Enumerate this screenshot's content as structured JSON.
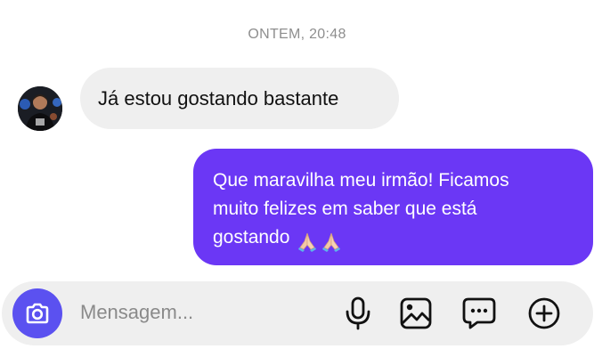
{
  "thread": {
    "timestamp": "ONTEM, 20:48"
  },
  "messages": [
    {
      "direction": "incoming",
      "text": "Já estou gostando bastante"
    },
    {
      "direction": "outgoing",
      "lines": [
        "Que maravilha meu irmão! Ficamos",
        "muito felizes em saber que está",
        "gostando"
      ],
      "emoji": [
        "folded-hands",
        "folded-hands"
      ]
    }
  ],
  "composer": {
    "placeholder": "Mensagem...",
    "icons": [
      "camera-icon",
      "microphone-icon",
      "image-icon",
      "sticker-message-icon",
      "plus-circle-icon"
    ]
  },
  "colors": {
    "outgoing_bubble": "#6b37f5",
    "incoming_bubble": "#efefef",
    "camera_button": "#5b51f0",
    "timestamp": "#8e8e8e"
  }
}
